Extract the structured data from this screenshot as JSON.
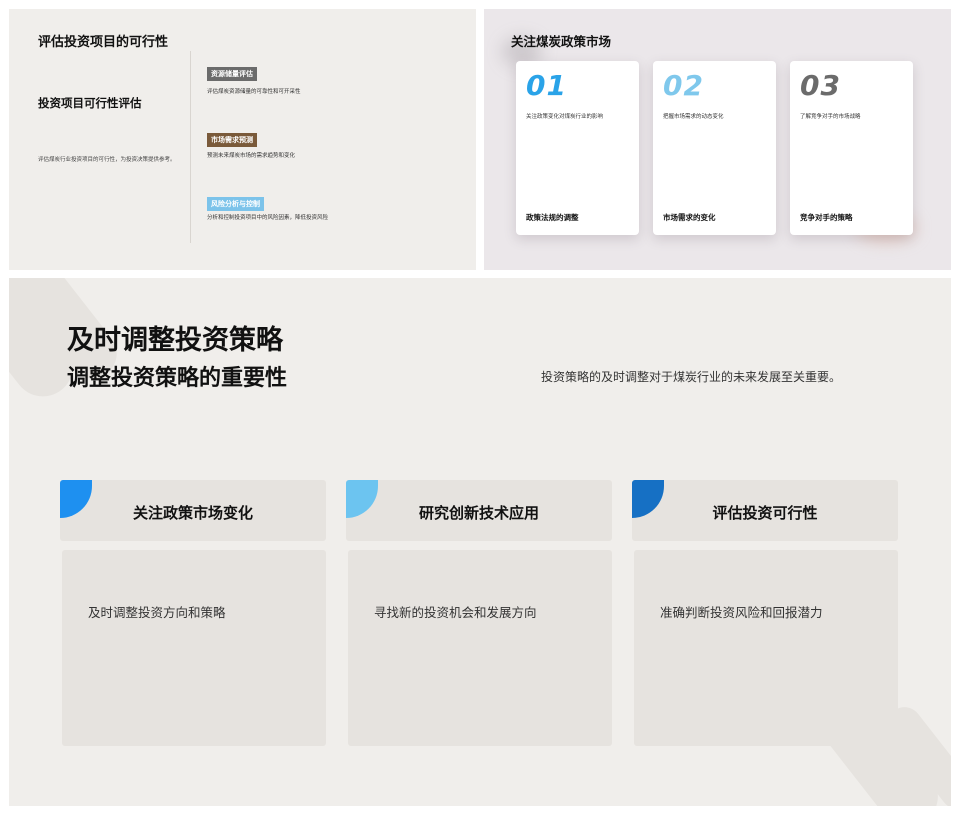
{
  "slide1": {
    "title": "评估投资项目的可行性",
    "subtitle": "投资项目可行性评估",
    "description": "评估煤炭行业投资项目的可行性，为投资决策提供参考。",
    "items": [
      {
        "tag": "资源储量评估",
        "desc": "评估煤炭资源储量的可靠性和可开采性",
        "color": "#6b6b6b"
      },
      {
        "tag": "市场需求预测",
        "desc": "预测未来煤炭市场的需求趋势和变化",
        "color": "#7a5a3a"
      },
      {
        "tag": "风险分析与控制",
        "desc": "分析和控制投资项目中的风险因素，降低投资风险",
        "color": "#7cc3ea"
      }
    ]
  },
  "slide2": {
    "title": "关注煤炭政策市场",
    "cards": [
      {
        "num": "01",
        "desc": "关注政策变化对煤炭行业的影响",
        "footer": "政策法规的调整",
        "color": "#2aa3e8"
      },
      {
        "num": "02",
        "desc": "把握市场需求的动态变化",
        "footer": "市场需求的变化",
        "color": "#7fc8ec"
      },
      {
        "num": "03",
        "desc": "了解竞争对手的市场战略",
        "footer": "竞争对手的策略",
        "color": "#6b6b6b"
      }
    ]
  },
  "slide3": {
    "heading": "及时调整投资策略",
    "subheading": "调整投资策略的重要性",
    "lead": "投资策略的及时调整对于煤炭行业的未来发展至关重要。",
    "columns": [
      {
        "title": "关注政策市场变化",
        "body": "及时调整投资方向和策略",
        "accent": "#1e90f0"
      },
      {
        "title": "研究创新技术应用",
        "body": "寻找新的投资机会和发展方向",
        "accent": "#6cc4f0"
      },
      {
        "title": "评估投资可行性",
        "body": "准确判断投资风险和回报潜力",
        "accent": "#1670c4"
      }
    ]
  }
}
